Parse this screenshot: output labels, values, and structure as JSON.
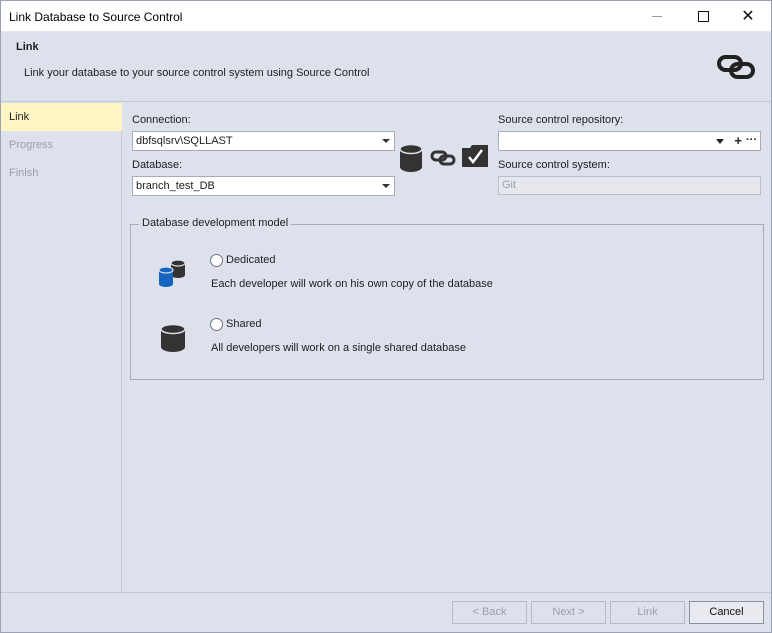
{
  "window": {
    "title": "Link Database to Source Control"
  },
  "header": {
    "title": "Link",
    "description": "Link your database to your source control system using Source Control"
  },
  "sidebar": {
    "items": [
      {
        "label": "Link"
      },
      {
        "label": "Progress"
      },
      {
        "label": "Finish"
      }
    ]
  },
  "connection": {
    "label": "Connection:",
    "value": "dbfsqlsrv\\SQLLAST"
  },
  "database": {
    "label": "Database:",
    "value": "branch_test_DB"
  },
  "repository": {
    "label": "Source control repository:",
    "value": "",
    "add_symbol": "+",
    "more_symbol": "···"
  },
  "system": {
    "label": "Source control system:",
    "value": "Git"
  },
  "dev_model": {
    "title": "Database development model",
    "dedicated": {
      "label": "Dedicated",
      "description": "Each developer will work on his own copy of the database"
    },
    "shared": {
      "label": "Shared",
      "description": "All developers will work on a single shared database"
    }
  },
  "footer": {
    "back": "< Back",
    "next": "Next >",
    "link": "Link",
    "cancel": "Cancel"
  },
  "colors": {
    "active_sidebar": "#fff5c4",
    "db_blue": "#1565c0",
    "icon_dark": "#333333"
  }
}
